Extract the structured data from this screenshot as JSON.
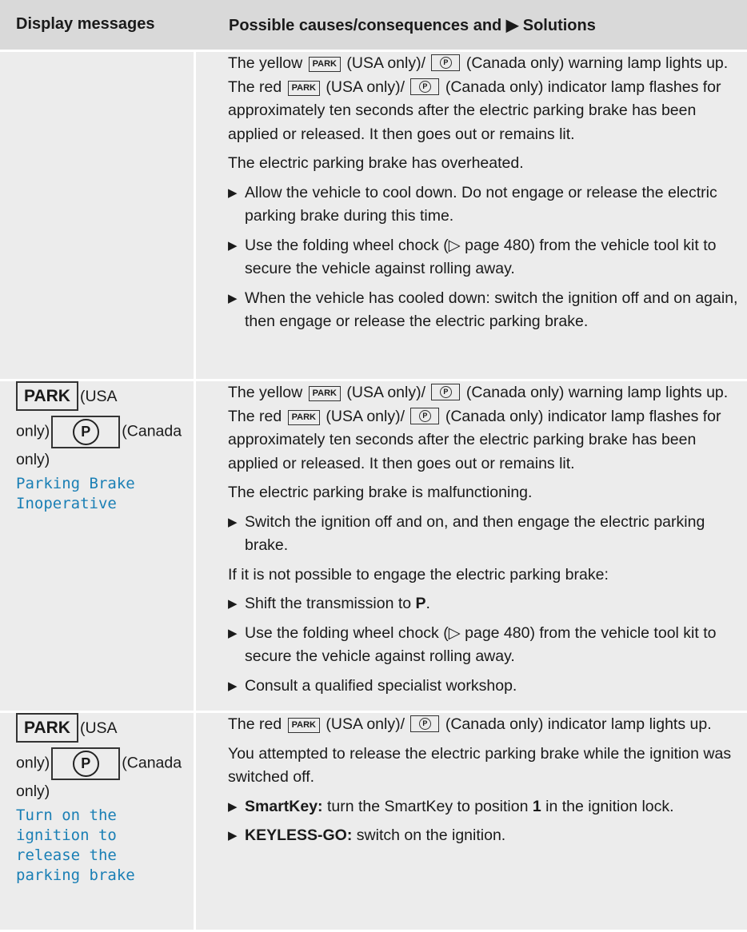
{
  "header": {
    "col1": "Display messages",
    "col2": "Possible causes/consequences and ▶ Solutions"
  },
  "lamps": {
    "park": "PARK",
    "p_symbol": "P"
  },
  "rows": [
    {
      "para1_pre": "The yellow ",
      "para1_a": " (USA only)/ ",
      "para1_b": " (Canada only) warning lamp lights up. The red ",
      "para1_c": " (USA only)/ ",
      "para1_d": " (Canada only) indicator lamp flashes for approximately ten seconds after the electric parking brake has been applied or released. It then goes out or remains lit.",
      "cause": "The electric parking brake has overheated.",
      "bullets": [
        "Allow the vehicle to cool down. Do not engage or release the electric parking brake during this time.",
        "Use the folding wheel chock (▷ page 480) from the vehicle tool kit to secure the vehicle against rolling away.",
        "When the vehicle has cooled down: switch the ignition off and on again, then engage or release the electric parking brake."
      ]
    },
    {
      "left_usa": "(USA",
      "left_only": "only)",
      "left_canada": "(Canada",
      "left_only2": "only)",
      "message": "Parking Brake Inoperative",
      "para1_pre": "The yellow ",
      "para1_a": " (USA only)/ ",
      "para1_b": " (Canada only) warning lamp lights up. The red ",
      "para1_c": " (USA only)/ ",
      "para1_d": " (Canada only) indicator lamp flashes for approximately ten seconds after the electric parking brake has been applied or released. It then goes out or remains lit.",
      "cause": "The electric parking brake is malfunctioning.",
      "bullet1": "Switch the ignition off and on, and then engage the electric parking brake.",
      "condition": "If it is not possible to engage the electric parking brake:",
      "bullet2_pre": "Shift the transmission to ",
      "bullet2_bold": "P",
      "bullet2_post": ".",
      "bullet3": "Use the folding wheel chock (▷ page 480) from the vehicle tool kit to secure the vehicle against rolling away.",
      "bullet4": "Consult a qualified specialist workshop."
    },
    {
      "left_usa": "(USA",
      "left_only": "only)",
      "left_canada": "(Canada",
      "left_only2": "only)",
      "message": "Turn on the ignition to release the parking brake",
      "para1_pre": "The red ",
      "para1_a": " (USA only)/ ",
      "para1_b": " (Canada only) indicator lamp lights up.",
      "cause": "You attempted to release the electric parking brake while the ignition was switched off.",
      "bullet1_bold": "SmartKey:",
      "bullet1_a": " turn the SmartKey to position ",
      "bullet1_num": "1",
      "bullet1_b": " in the ignition lock.",
      "bullet2_bold": "KEYLESS-GO:",
      "bullet2": " switch on the ignition."
    }
  ],
  "arrow": "▶"
}
